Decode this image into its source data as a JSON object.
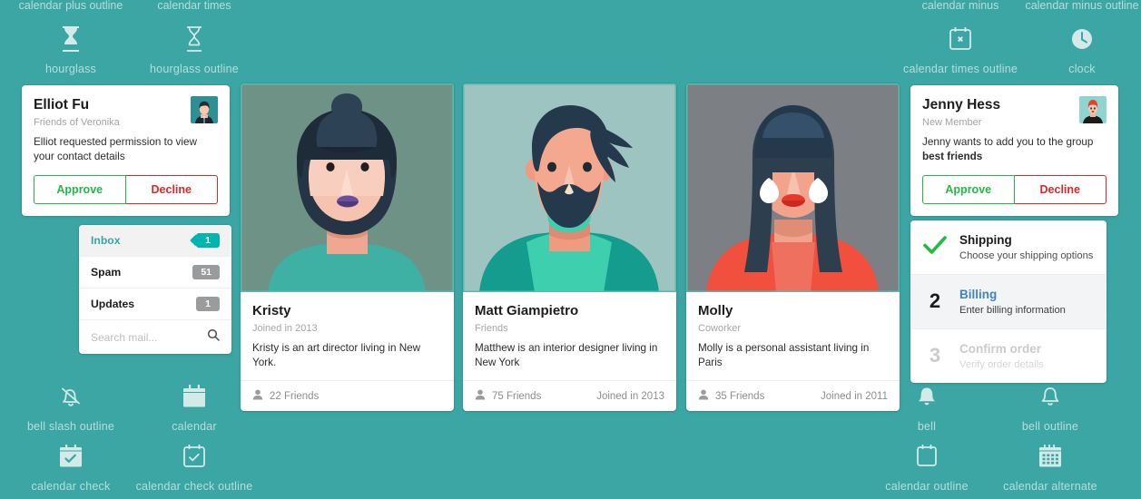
{
  "theme": {
    "background": "#3ba6a4",
    "icon_label_color": "#c6e3e2",
    "approve_color": "#21ba45",
    "decline_color": "#db2828",
    "teal_badge": "#00b5ad",
    "active_step_link": "#4183c4",
    "inbox_active": "#37a6a4"
  },
  "icons": {
    "top_labels": [
      {
        "text": "calendar plus outline"
      },
      {
        "text": "calendar times"
      },
      {
        "text": "calendar minus"
      },
      {
        "text": "calendar minus outline"
      }
    ],
    "row1": [
      {
        "name": "hourglass-icon",
        "label": "hourglass",
        "style": "solid"
      },
      {
        "name": "hourglass-outline-icon",
        "label": "hourglass outline",
        "style": "outline"
      },
      {
        "name": "calendar-times-outline-icon",
        "label": "calendar times outline",
        "style": "outline"
      },
      {
        "name": "clock-icon",
        "label": "clock",
        "style": "solid"
      }
    ],
    "row2": [
      {
        "name": "bell-slash-outline-icon",
        "label": "bell slash outline",
        "style": "outline"
      },
      {
        "name": "calendar-icon",
        "label": "calendar",
        "style": "solid"
      },
      {
        "name": "bell-icon",
        "label": "bell",
        "style": "solid"
      },
      {
        "name": "bell-outline-icon",
        "label": "bell outline",
        "style": "outline"
      }
    ],
    "row3": [
      {
        "name": "calendar-check-icon",
        "label": "calendar check",
        "style": "solid"
      },
      {
        "name": "calendar-check-outline-icon",
        "label": "calendar check outline",
        "style": "outline"
      },
      {
        "name": "calendar-outline-icon",
        "label": "calendar outline",
        "style": "outline"
      },
      {
        "name": "calendar-alternate-icon",
        "label": "calendar alternate",
        "style": "solid"
      }
    ]
  },
  "requests": [
    {
      "id": "elliot",
      "name": "Elliot Fu",
      "meta": "Friends of Veronika",
      "text_plain": "Elliot requested permission to view your contact details",
      "text_pre": "Elliot requested permission to view your contact details",
      "text_bold": "",
      "text_post": "",
      "approve_label": "Approve",
      "decline_label": "Decline"
    },
    {
      "id": "jenny",
      "name": "Jenny Hess",
      "meta": "New Member",
      "text_plain": "Jenny wants to add you to the group best friends",
      "text_pre": "Jenny wants to add you to the group ",
      "text_bold": "best friends",
      "text_post": "",
      "approve_label": "Approve",
      "decline_label": "Decline"
    }
  ],
  "profiles": [
    {
      "id": "kristy",
      "name": "Kristy",
      "meta": "Joined in 2013",
      "description": "Kristy is an art director living in New York.",
      "friends": "22 Friends",
      "joined": ""
    },
    {
      "id": "matt",
      "name": "Matt Giampietro",
      "meta": "Friends",
      "description": "Matthew is an interior designer living in New York",
      "friends": "75 Friends",
      "joined": "Joined in 2013"
    },
    {
      "id": "molly",
      "name": "Molly",
      "meta": "Coworker",
      "description": "Molly is a personal assistant living in Paris",
      "friends": "35 Friends",
      "joined": "Joined in 2011"
    }
  ],
  "menu": {
    "items": [
      {
        "label": "Inbox",
        "badge": "1",
        "active": true
      },
      {
        "label": "Spam",
        "badge": "51",
        "active": false
      },
      {
        "label": "Updates",
        "badge": "1",
        "active": false
      }
    ],
    "search": {
      "placeholder": "Search mail...",
      "value": ""
    }
  },
  "steps": [
    {
      "indicator": "check",
      "number": "",
      "title": "Shipping",
      "description": "Choose your shipping options",
      "state": "completed"
    },
    {
      "indicator": "number",
      "number": "2",
      "title": "Billing",
      "description": "Enter billing information",
      "state": "active"
    },
    {
      "indicator": "number",
      "number": "3",
      "title": "Confirm order",
      "description": "Verify order details",
      "state": "disabled"
    }
  ]
}
